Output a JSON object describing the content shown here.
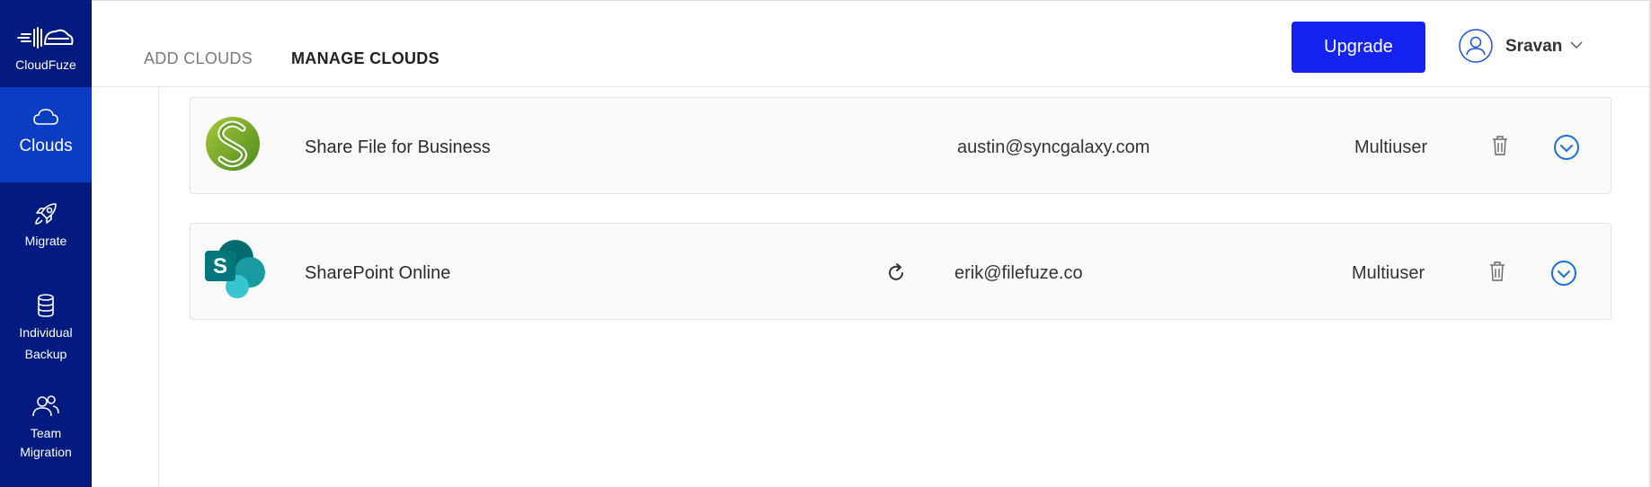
{
  "sidebar": {
    "brand": "CloudFuze",
    "items": [
      {
        "label": "Clouds",
        "icon": "cloud-icon",
        "active": true
      },
      {
        "label": "Migrate",
        "icon": "rocket-icon",
        "active": false
      },
      {
        "label_line1": "Individual",
        "label_line2": "Backup",
        "icon": "database-icon",
        "active": false
      },
      {
        "label_line1": "Team",
        "label_line2": "Migration",
        "icon": "users-icon",
        "active": false
      }
    ]
  },
  "header": {
    "tabs": [
      {
        "label": "ADD CLOUDS",
        "active": false
      },
      {
        "label": "MANAGE CLOUDS",
        "active": true
      }
    ],
    "upgrade_label": "Upgrade",
    "user_name": "Sravan"
  },
  "clouds": [
    {
      "name": "Share File for Business",
      "email": "austin@syncgalaxy.com",
      "type": "Multiuser",
      "logo": "sharefile-logo"
    },
    {
      "name": "SharePoint Online",
      "email": "erik@filefuze.co",
      "type": "Multiuser",
      "logo": "sharepoint-logo",
      "has_refresh": true
    }
  ],
  "colors": {
    "sidebar_bg": "#031a80",
    "sidebar_active": "#0b3cc4",
    "upgrade_button": "#1423f0",
    "expand_icon": "#1a6fe0"
  }
}
